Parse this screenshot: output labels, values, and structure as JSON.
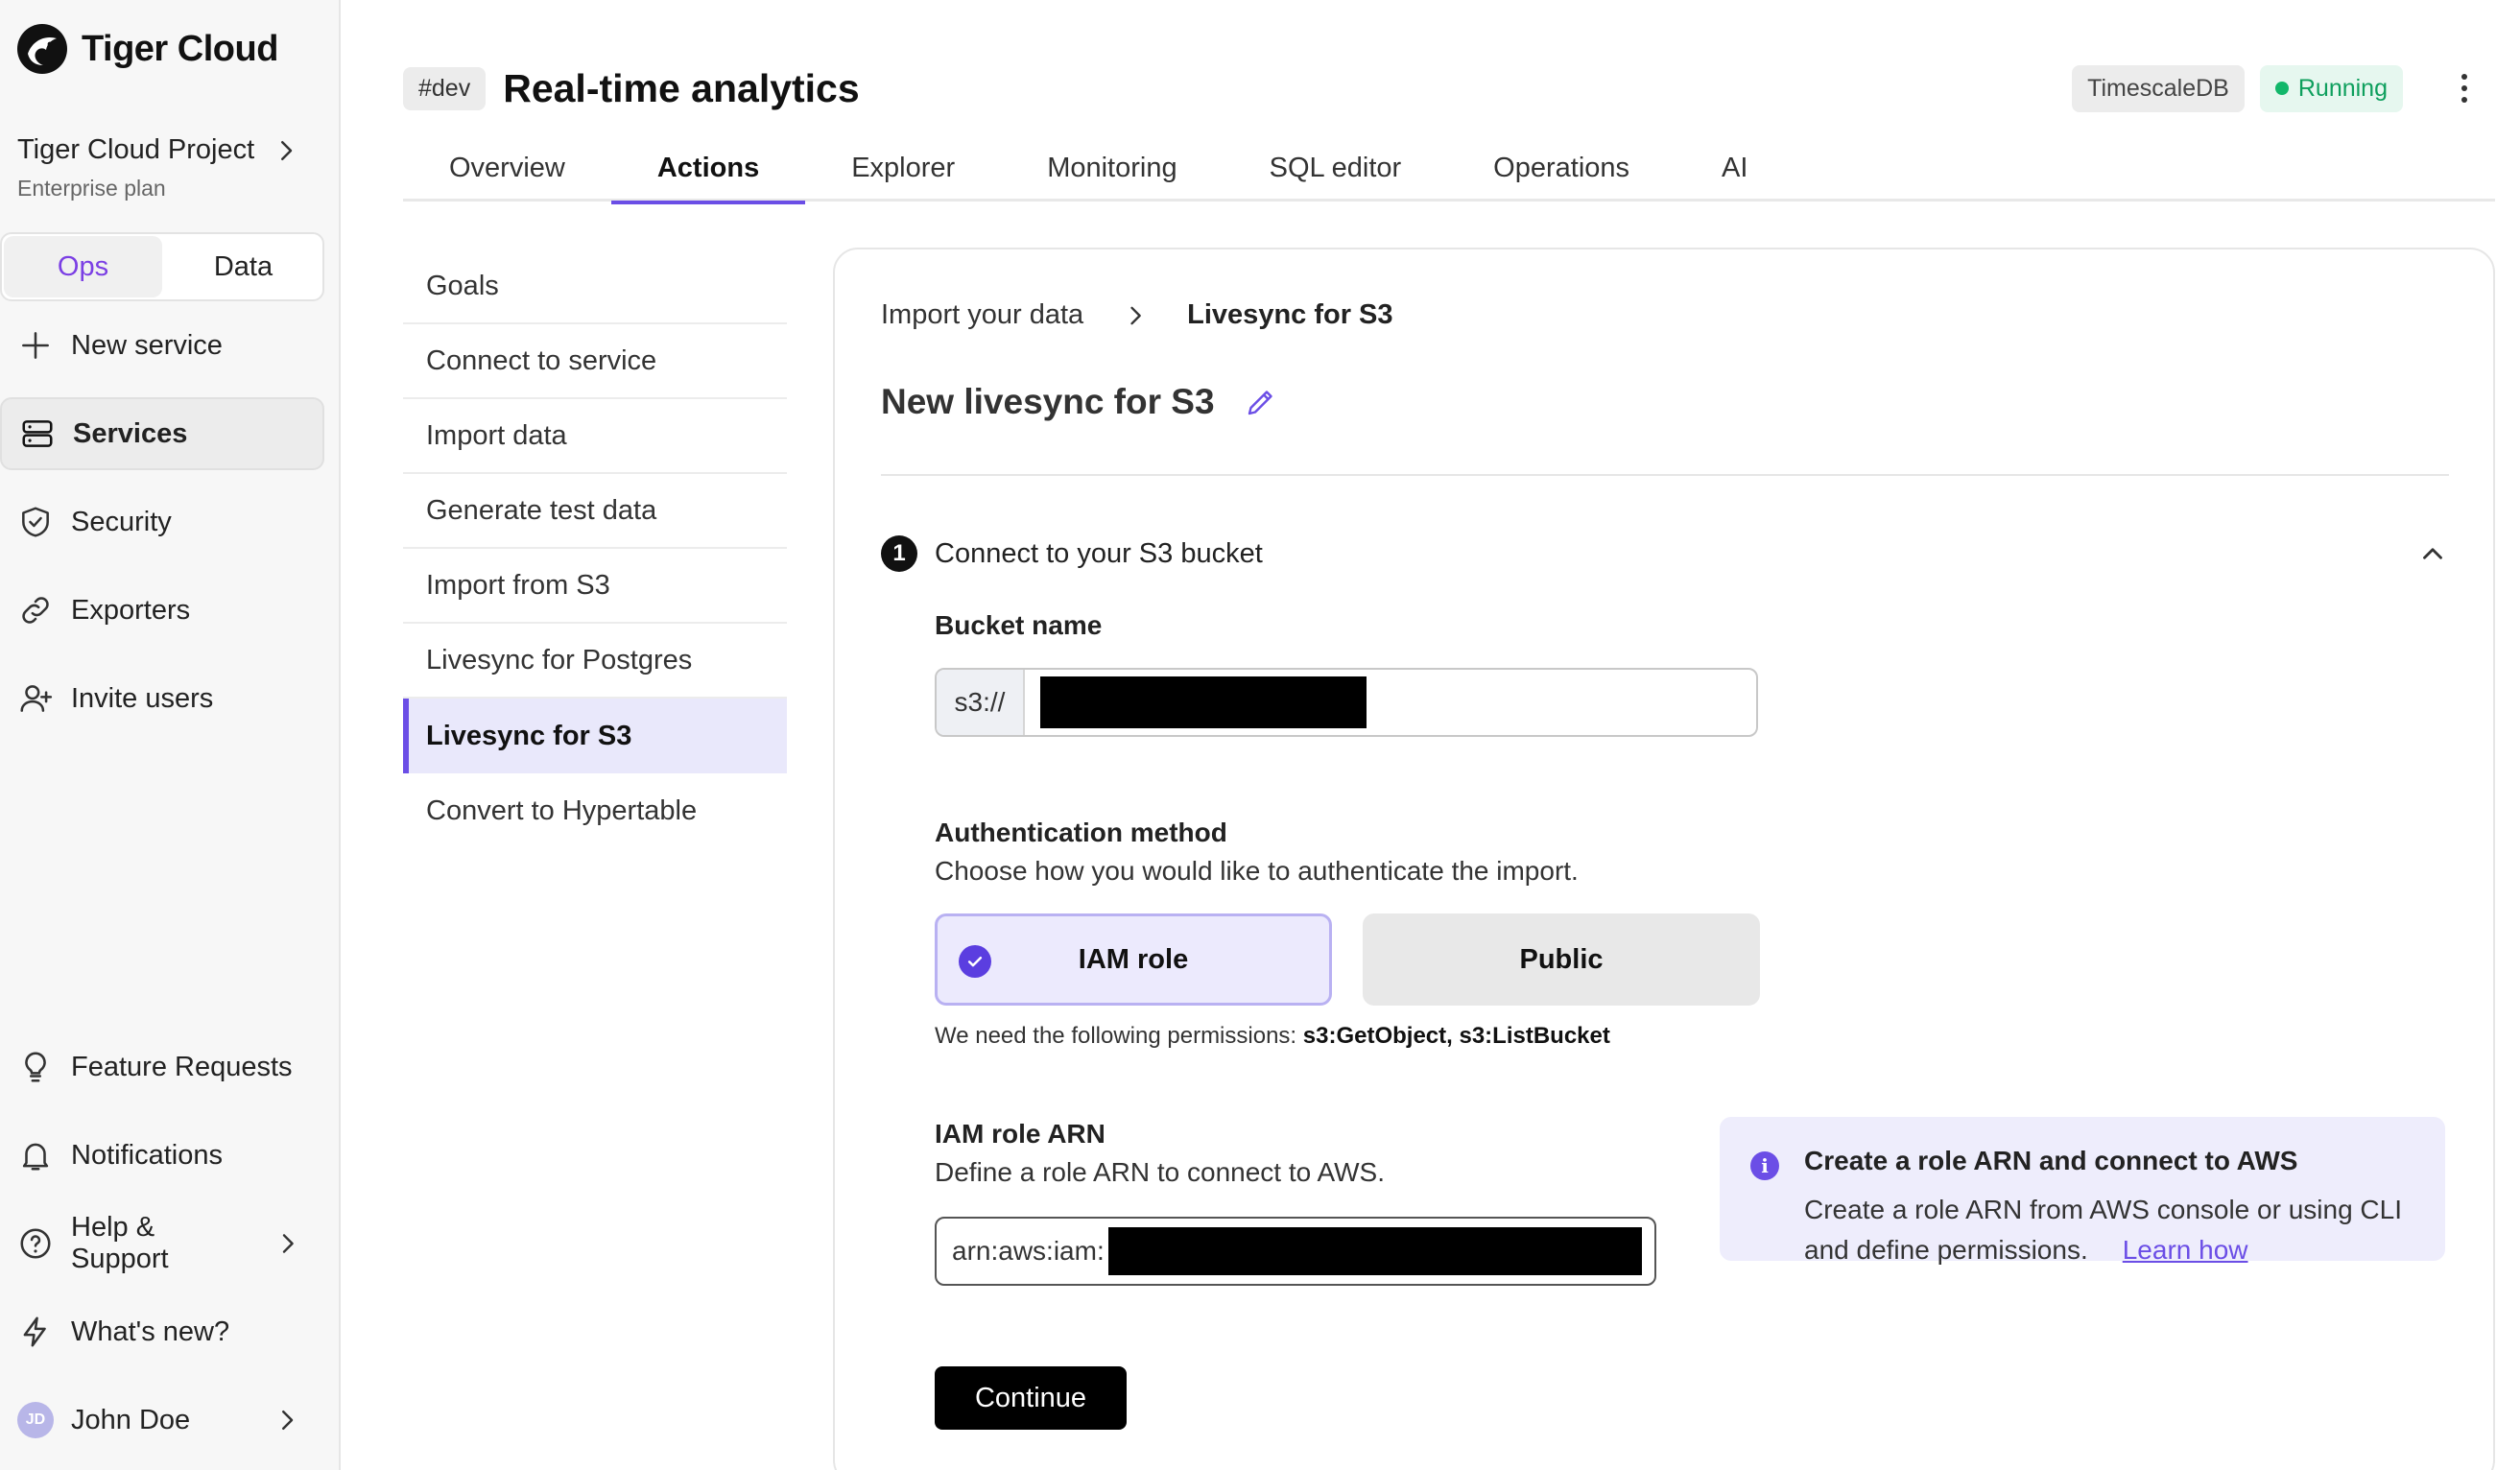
{
  "brand": {
    "name": "Tiger Cloud"
  },
  "project": {
    "name": "Tiger Cloud Project",
    "plan": "Enterprise plan"
  },
  "mode_toggle": {
    "ops": "Ops",
    "data": "Data",
    "selected": "Ops"
  },
  "sidebar": {
    "items": [
      {
        "label": "New service",
        "icon": "plus-icon"
      },
      {
        "label": "Services",
        "icon": "server-icon",
        "active": true
      },
      {
        "label": "Security",
        "icon": "shield-check-icon"
      },
      {
        "label": "Exporters",
        "icon": "link-icon"
      },
      {
        "label": "Invite users",
        "icon": "user-plus-icon"
      }
    ],
    "bottom": [
      {
        "label": "Feature Requests",
        "icon": "lightbulb-icon"
      },
      {
        "label": "Notifications",
        "icon": "bell-icon"
      },
      {
        "label": "Help & Support",
        "icon": "help-circle-icon"
      },
      {
        "label": "What's new?",
        "icon": "lightning-icon"
      }
    ],
    "user": {
      "initials": "JD",
      "name": "John Doe"
    }
  },
  "header": {
    "env_tag": "#dev",
    "title": "Real-time analytics",
    "db_badge": "TimescaleDB",
    "status": "Running"
  },
  "tabs": [
    {
      "label": "Overview"
    },
    {
      "label": "Actions",
      "active": true
    },
    {
      "label": "Explorer"
    },
    {
      "label": "Monitoring"
    },
    {
      "label": "SQL editor"
    },
    {
      "label": "Operations"
    },
    {
      "label": "AI"
    }
  ],
  "subnav": [
    {
      "label": "Goals"
    },
    {
      "label": "Connect to service"
    },
    {
      "label": "Import data"
    },
    {
      "label": "Generate test data"
    },
    {
      "label": "Import from S3"
    },
    {
      "label": "Livesync for Postgres"
    },
    {
      "label": "Livesync for S3",
      "active": true
    },
    {
      "label": "Convert to Hypertable"
    }
  ],
  "main": {
    "breadcrumb": {
      "parent": "Import your data",
      "current": "Livesync for S3"
    },
    "title": "New livesync for S3",
    "step": {
      "number": "1",
      "title": "Connect to your S3 bucket"
    },
    "bucket": {
      "label": "Bucket name",
      "prefix": "s3://",
      "value": ""
    },
    "auth": {
      "label": "Authentication method",
      "sub": "Choose how you would like to authenticate the import.",
      "options": [
        "IAM role",
        "Public"
      ],
      "selected": "IAM role",
      "perm_prefix": "We need the following permissions:",
      "perm_values": "s3:GetObject, s3:ListBucket"
    },
    "arn": {
      "label": "IAM role ARN",
      "sub": "Define a role ARN to connect to AWS.",
      "prefix": "arn:aws:iam:"
    },
    "info": {
      "title": "Create a role ARN and connect to AWS",
      "body": "Create a role ARN from AWS console or using CLI and define permissions.",
      "link": "Learn how"
    },
    "continue": "Continue"
  },
  "colors": {
    "accent": "#6b4ee6",
    "status_green": "#12b76a",
    "primary_button": "#000000"
  }
}
